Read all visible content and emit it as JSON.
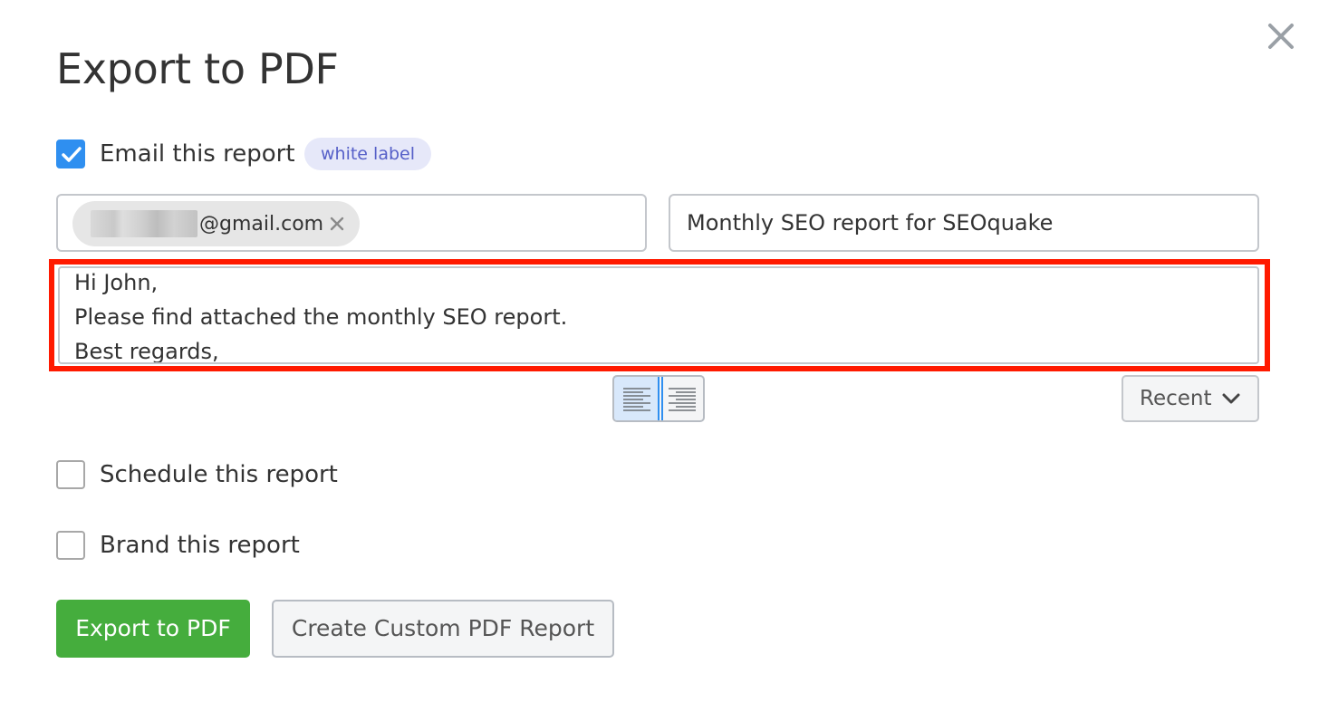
{
  "dialog": {
    "title": "Export to PDF"
  },
  "email": {
    "checkbox_label": "Email this report",
    "checked": true,
    "badge": "white label",
    "recipient_suffix": "@gmail.com",
    "subject": "Monthly SEO report for SEOquake",
    "message_lines": [
      "Hi John,",
      "Please find attached the monthly SEO report.",
      "Best regards,"
    ],
    "recent_label": "Recent"
  },
  "schedule": {
    "label": "Schedule this report",
    "checked": false
  },
  "brand": {
    "label": "Brand this report",
    "checked": false
  },
  "buttons": {
    "export": "Export to PDF",
    "custom": "Create Custom PDF Report"
  },
  "icons": {
    "close": "close-icon",
    "check": "checkmark-icon",
    "chip_remove": "remove-icon",
    "align_left": "align-left-icon",
    "align_right": "align-right-icon",
    "chevron": "chevron-down-icon"
  },
  "colors": {
    "primary_green": "#45ad3d",
    "checkbox_blue": "#2f8ff0",
    "highlight_red": "#ff1a00",
    "badge_bg": "#e6e8f9",
    "badge_text": "#5660c8"
  }
}
